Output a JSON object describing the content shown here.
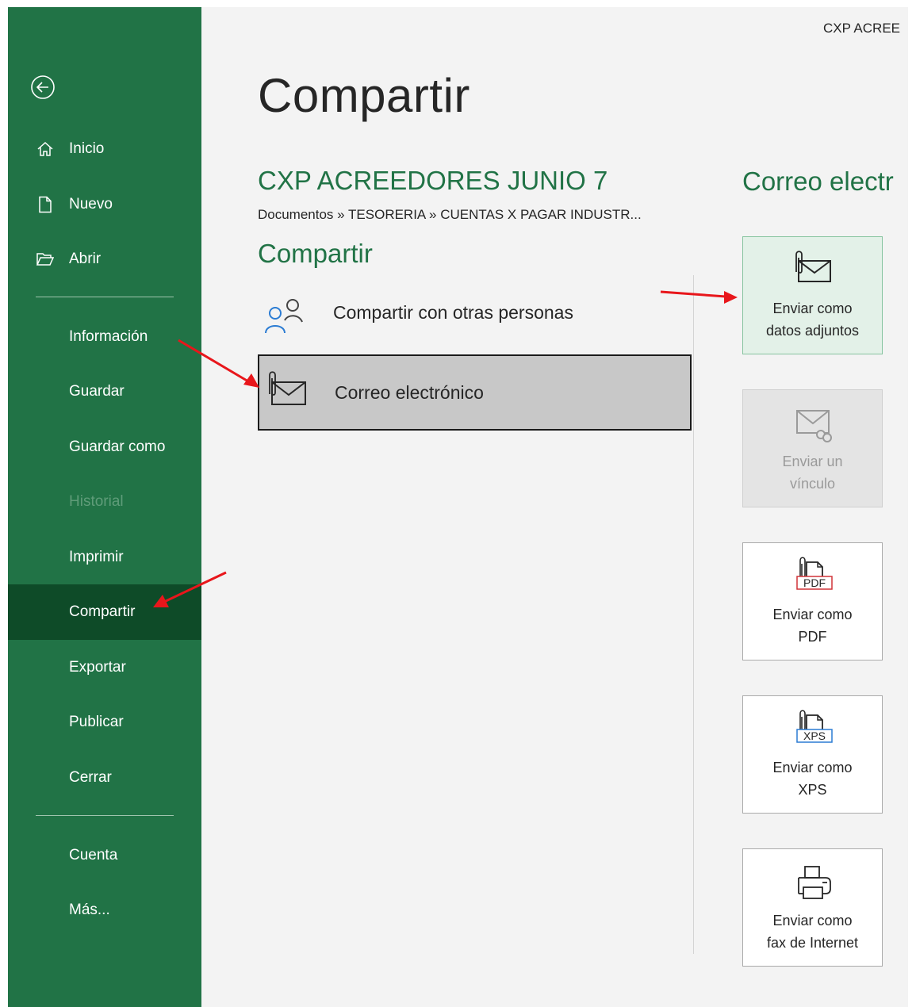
{
  "window": {
    "title_truncated": "CXP ACREE"
  },
  "sidebar": {
    "items": [
      {
        "label": "Inicio",
        "icon": "home-icon"
      },
      {
        "label": "Nuevo",
        "icon": "new-document-icon"
      },
      {
        "label": "Abrir",
        "icon": "open-folder-icon"
      },
      {
        "label": "Información"
      },
      {
        "label": "Guardar"
      },
      {
        "label": "Guardar como"
      },
      {
        "label": "Historial",
        "state": "disabled"
      },
      {
        "label": "Imprimir"
      },
      {
        "label": "Compartir",
        "state": "active"
      },
      {
        "label": "Exportar"
      },
      {
        "label": "Publicar"
      },
      {
        "label": "Cerrar"
      },
      {
        "label": "Cuenta"
      },
      {
        "label": "Más..."
      }
    ]
  },
  "main": {
    "title": "Compartir",
    "document_name": "CXP ACREEDORES JUNIO 7",
    "breadcrumb": "Documentos » TESORERIA » CUENTAS X PAGAR INDUSTR...",
    "section_title": "Compartir",
    "options": [
      {
        "label": "Compartir con otras personas",
        "icon": "people-icon"
      },
      {
        "label": "Correo electrónico",
        "icon": "email-attachment-icon",
        "state": "selected"
      }
    ]
  },
  "right_panel": {
    "title": "Correo electr",
    "tiles": [
      {
        "line1": "Enviar como",
        "line2": "datos adjuntos",
        "icon": "email-attachment-icon",
        "state": "selected"
      },
      {
        "line1": "Enviar un",
        "line2": "vínculo",
        "icon": "email-link-icon",
        "state": "disabled"
      },
      {
        "line1": "Enviar como",
        "line2": "PDF",
        "icon": "pdf-attachment-icon",
        "badge": "PDF"
      },
      {
        "line1": "Enviar como",
        "line2": "XPS",
        "icon": "xps-attachment-icon",
        "badge": "XPS"
      },
      {
        "line1": "Enviar como",
        "line2": "fax de Internet",
        "icon": "fax-icon"
      }
    ]
  },
  "colors": {
    "brand_green": "#217346",
    "active_nav": "#0e4b28",
    "annotation_arrow": "#e8161b",
    "pdf_red": "#d13438",
    "xps_blue": "#2b7cd3"
  }
}
